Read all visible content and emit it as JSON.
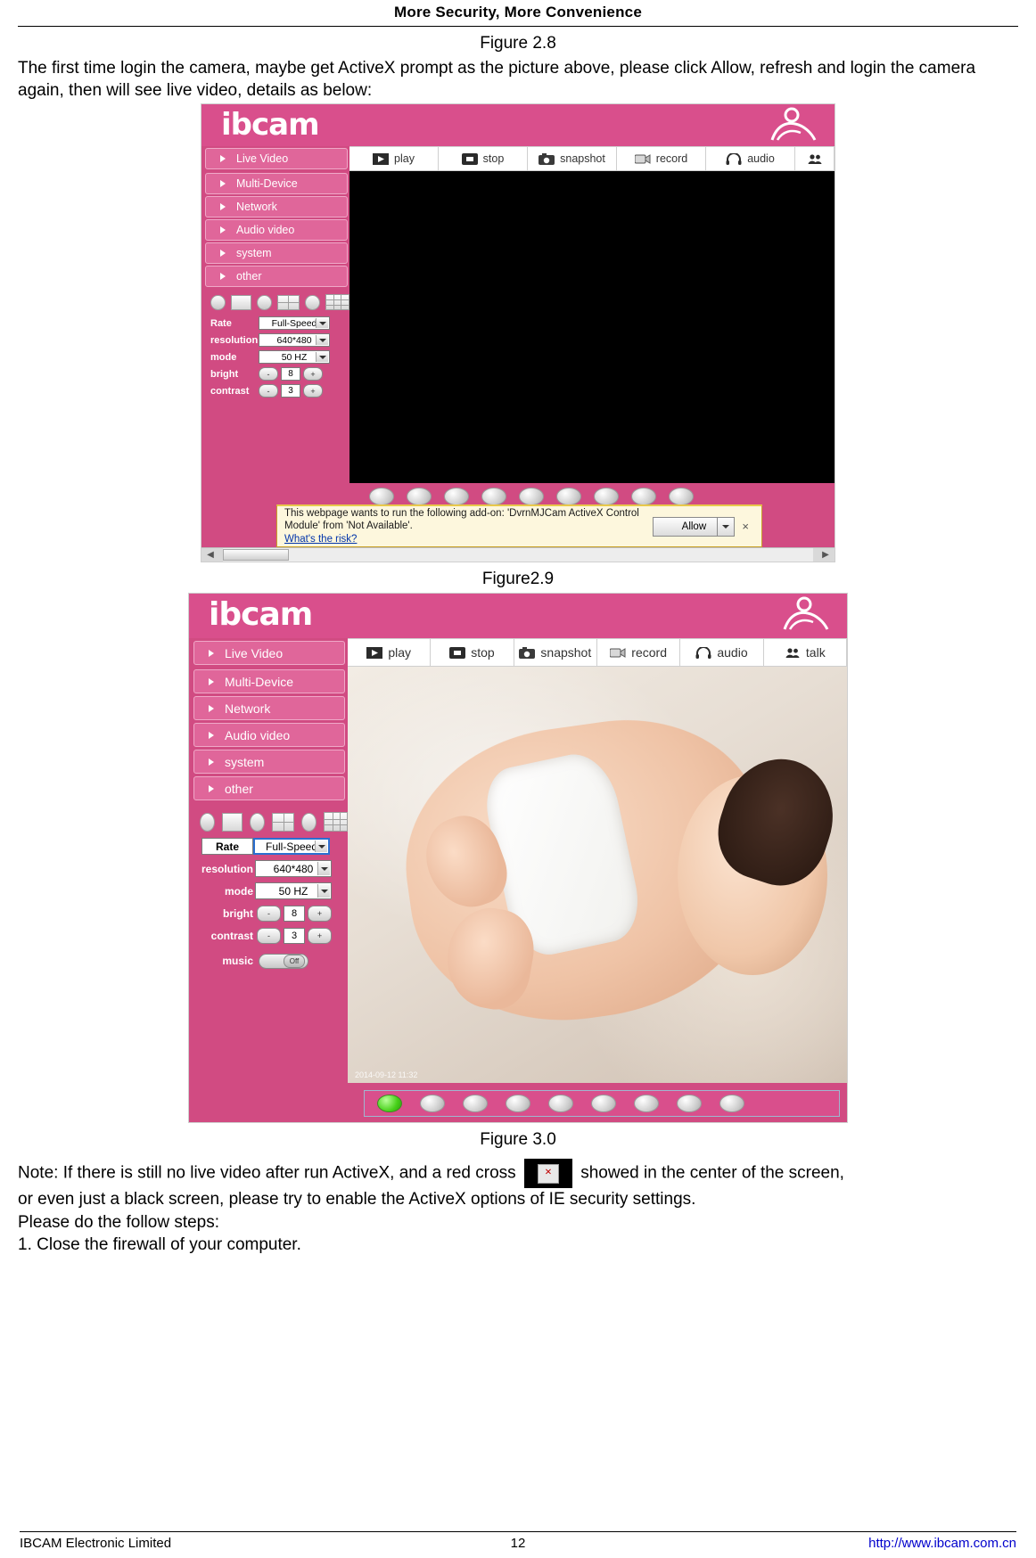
{
  "header": {
    "title": "More Security, More Convenience"
  },
  "figures": {
    "fig28_label": "Figure 2.8",
    "fig29_label": "Figure2.9",
    "fig30_label": "Figure 3.0"
  },
  "paragraph1": "The first time login the camera, maybe get ActiveX prompt as the picture above, please click Allow, refresh and login the camera again, then will see live video, details as below:",
  "camera_ui": {
    "logo": "ibcam",
    "nav": [
      {
        "label": "Live Video"
      },
      {
        "label": "Multi-Device"
      },
      {
        "label": "Network"
      },
      {
        "label": "Audio video"
      },
      {
        "label": "system"
      },
      {
        "label": "other"
      }
    ],
    "toolbar": [
      {
        "label": "play",
        "icon": "play-icon"
      },
      {
        "label": "stop",
        "icon": "stop-icon"
      },
      {
        "label": "snapshot",
        "icon": "camera-icon"
      },
      {
        "label": "record",
        "icon": "video-record-icon"
      },
      {
        "label": "audio",
        "icon": "headphone-icon"
      },
      {
        "label": "talk",
        "icon": "people-icon"
      }
    ],
    "settings": {
      "rate_label": "Rate",
      "rate_value": "Full-Speed",
      "resolution_label": "resolution",
      "resolution_value": "640*480",
      "mode_label": "mode",
      "mode_value": "50 HZ",
      "bright_label": "bright",
      "bright_value": "8",
      "contrast_label": "contrast",
      "contrast_value": "3",
      "music_label": "music",
      "music_value": "Off",
      "minus": "-",
      "plus": "+"
    },
    "video_timestamp": "2014-09-12 11:32"
  },
  "activex_prompt": {
    "line1": "This webpage wants to run the following add-on: 'DvrnMJCam ActiveX Control",
    "line2": "Module' from 'Not Available'.",
    "link": "What's the risk?",
    "allow_label": "Allow",
    "close_label": "×"
  },
  "note": {
    "line1_a": "Note: If there is still no live video after run ActiveX, and a red cross",
    "cross_glyph": "×",
    "line1_b": "showed in the center of the screen,",
    "line2": "or even just a black screen, please try to enable the ActiveX options of IE security settings.",
    "line3": "Please do the follow steps:",
    "line4": "1. Close the firewall of your computer."
  },
  "footer": {
    "left": "IBCAM Electronic Limited",
    "center": "12",
    "right": "http://www.ibcam.com.cn"
  }
}
